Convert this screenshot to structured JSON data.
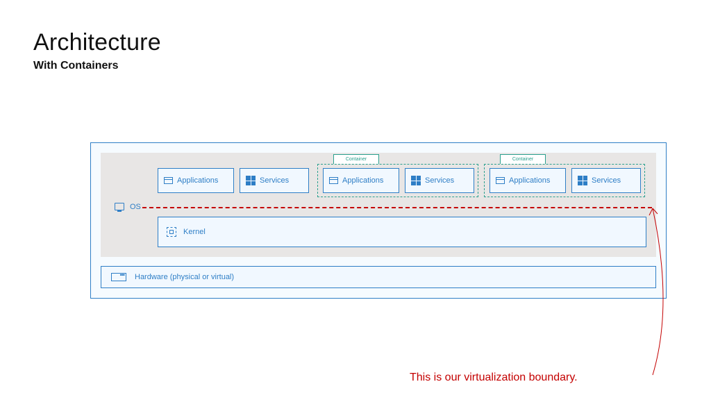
{
  "title": "Architecture",
  "subtitle": "With Containers",
  "os_label": "OS",
  "groups": [
    {
      "tab": "Container"
    },
    {
      "tab": "Container"
    }
  ],
  "blocks": {
    "b1": "Applications",
    "b2": "Services",
    "b3": "Applications",
    "b4": "Services",
    "b5": "Applications",
    "b6": "Services"
  },
  "kernel": "Kernel",
  "hardware": "Hardware (physical or virtual)",
  "annotation": "This is our virtualization boundary.",
  "colors": {
    "blue": "#2e7ec6",
    "teal": "#2aa08e",
    "red": "#c40000"
  }
}
